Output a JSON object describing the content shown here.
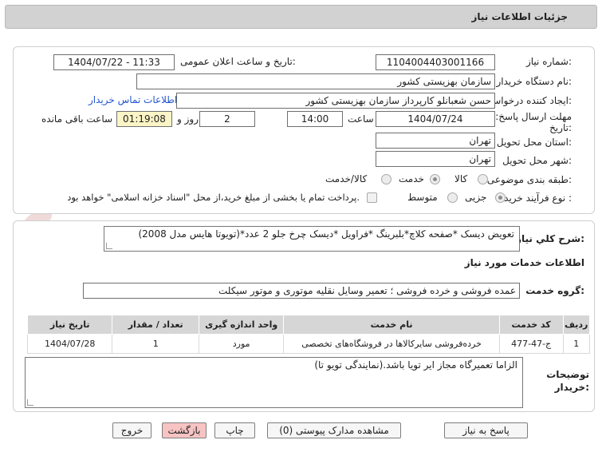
{
  "header": {
    "title": "جزئیات اطلاعات نیاز"
  },
  "fields": {
    "need_number_label": "شماره نیاز:",
    "need_number": "1104004403001166",
    "announce_label": "تاریخ و ساعت اعلان عمومی:",
    "announce_value": "1404/07/22 - 11:33",
    "buyer_org_label": "نام دستگاه خریدار:",
    "buyer_org": "سازمان بهزیستی کشور",
    "creator_label": "ایجاد کننده درخواست:",
    "creator": "حسن  شعبانلو کارپرداز سازمان بهزیستی کشور",
    "contact_link": "اطلاعات تماس خریدار",
    "deadline_label_1": "مهلت ارسال پاسخ: تا",
    "deadline_label_2": "تاریخ:",
    "deadline_date": "1404/07/24",
    "time_label": "ساعت",
    "deadline_time": "14:00",
    "days_value": "2",
    "days_label": "روز و",
    "remaining_time": "01:19:08",
    "remaining_label": "ساعت باقی مانده",
    "province_label": "استان محل تحویل:",
    "province": "تهران",
    "city_label": "شهر محل تحویل:",
    "city": "تهران",
    "category_label": "طبقه بندی موضوعی:",
    "category_options": [
      "کالا",
      "خدمت",
      "کالا/خدمت"
    ],
    "process_label": "نوع فرآیند خرید :",
    "process_options": [
      "جزیی",
      "متوسط"
    ],
    "payment_note": "پرداخت تمام یا بخشی از مبلغ خرید،از محل \"اسناد خزانه اسلامی\" خواهد بود."
  },
  "description": {
    "label": "شرح کلي نياز:",
    "text": "تعویض دیسک *صفحه کلاچ*بلبرینگ *فراویل *دیسک چرخ جلو 2 عدد*(تویوتا هایس مدل 2008)"
  },
  "services": {
    "section_title": "اطلاعات خدمات مورد نياز",
    "group_label": "گروه خدمت:",
    "group_value": "عمده فروشی و خرده فروشی ؛ تعمیر وسایل نقلیه موتوری و موتور سیکلت",
    "columns": [
      "ردیف",
      "کد خدمت",
      "نام خدمت",
      "واحد اندازه گیری",
      "تعداد / مقدار",
      "تاریخ نیاز"
    ],
    "rows": [
      [
        "1",
        "ج-47-477",
        "خرده‌فروشی سایرکالاها در فروشگاه‌های تخصصی",
        "مورد",
        "1",
        "1404/07/28"
      ]
    ]
  },
  "buyer_notes": {
    "label_1": "توضیحات",
    "label_2": "خریدار:",
    "text": "الزاما تعمیرگاه مجاز ایر تویا باشد.(نمایندگی تویو تا)"
  },
  "buttons": {
    "reply": "پاسخ به نیاز",
    "docs": "مشاهده مدارک پیوستی (0)",
    "print": "چاپ",
    "back": "بازگشت",
    "exit": "خروج"
  },
  "colors": {
    "accent_link": "#2255cc",
    "remaining_bg": "#fbf4c6",
    "danger_button": "#f7c3c3"
  }
}
